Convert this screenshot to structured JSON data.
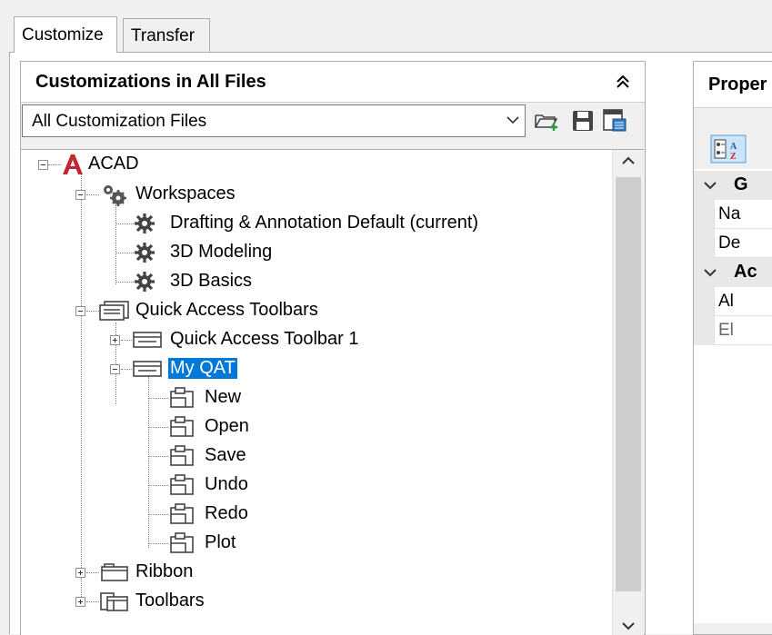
{
  "tabs": [
    {
      "label": "Customize",
      "active": true
    },
    {
      "label": "Transfer",
      "active": false
    }
  ],
  "left_panel": {
    "title": "Customizations in All Files",
    "file_filter": {
      "value": "All Customization Files"
    },
    "toolbar_icons": [
      "open-file-icon",
      "save-icon",
      "partial-customization-icon"
    ]
  },
  "tree": {
    "root": "ACAD",
    "workspaces": "Workspaces",
    "ws_items": [
      "Drafting & Annotation Default (current)",
      "3D Modeling",
      "3D Basics"
    ],
    "qat_group": "Quick Access Toolbars",
    "qat1": "Quick Access Toolbar 1",
    "myqat": "My QAT",
    "myqat_commands": [
      "New",
      "Open",
      "Save",
      "Undo",
      "Redo",
      "Plot"
    ],
    "ribbon": "Ribbon",
    "toolbars": "Toolbars"
  },
  "right_panel": {
    "title": "Proper",
    "categories": [
      {
        "label": "G",
        "props": [
          "Na",
          "De"
        ]
      },
      {
        "label": "Ac",
        "props": [
          "Al",
          "El"
        ]
      }
    ]
  },
  "colors": {
    "selection": "#0078d7",
    "acad_logo": "#c4262e"
  }
}
